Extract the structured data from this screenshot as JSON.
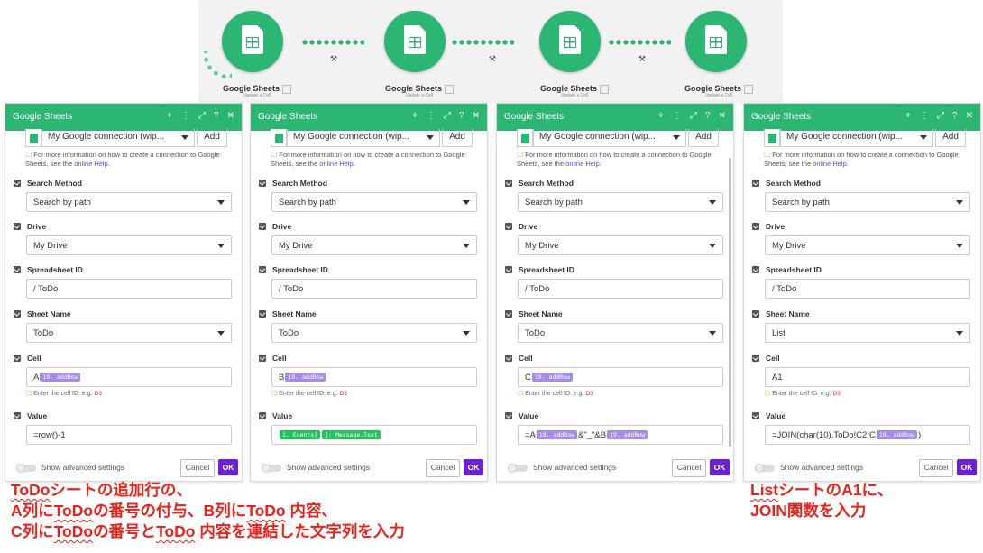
{
  "flow": {
    "nodes": [
      {
        "label": "Google Sheets",
        "sub": "Update a Cell"
      },
      {
        "label": "Google Sheets",
        "sub": "Update a Cell"
      },
      {
        "label": "Google Sheets",
        "sub": "Update a Cell"
      },
      {
        "label": "Google Sheets",
        "sub": "Update a Cell"
      }
    ],
    "accent": "#2bb673"
  },
  "panels": [
    {
      "title": "Google Sheets",
      "connection": "My Google connection (wip...",
      "add": "Add",
      "help_text": "For more information on how to create a connection to Google Sheets, see the",
      "help_link": "online Help.",
      "labels": {
        "search_method": "Search Method",
        "drive": "Drive",
        "spreadsheet_id": "Spreadsheet ID",
        "sheet_name": "Sheet Name",
        "cell": "Cell",
        "value": "Value"
      },
      "search_method": "Search by path",
      "drive": "My Drive",
      "spreadsheet_id": "/ ToDo",
      "sheet_name": "ToDo",
      "cell_prefix": "A",
      "cell_pill": "19. addRow",
      "cell_hint": "Enter the cell ID. e.g.",
      "cell_hint_code": "D3",
      "value_text": "=row()-1",
      "advanced": "Show advanced settings",
      "cancel": "Cancel",
      "ok": "OK"
    },
    {
      "title": "Google Sheets",
      "connection": "My Google connection (wip...",
      "add": "Add",
      "help_text": "For more information on how to create a connection to Google Sheets, see the",
      "help_link": "online Help.",
      "labels": {
        "search_method": "Search Method",
        "drive": "Drive",
        "spreadsheet_id": "Spreadsheet ID",
        "sheet_name": "Sheet Name",
        "cell": "Cell",
        "value": "Value"
      },
      "search_method": "Search by path",
      "drive": "My Drive",
      "spreadsheet_id": "/ ToDo",
      "sheet_name": "ToDo",
      "cell_prefix": "B",
      "cell_pill": "19. addRow",
      "cell_hint": "Enter the cell ID. e.g.",
      "cell_hint_code": "D3",
      "value_pill1": "1. Events[",
      "value_pill2": "]: Message.Text",
      "advanced": "Show advanced settings",
      "cancel": "Cancel",
      "ok": "OK"
    },
    {
      "title": "Google Sheets",
      "connection": "My Google connection (wip...",
      "add": "Add",
      "help_text": "For more information on how to create a connection to Google Sheets, see the",
      "help_link": "online Help.",
      "labels": {
        "search_method": "Search Method",
        "drive": "Drive",
        "spreadsheet_id": "Spreadsheet ID",
        "sheet_name": "Sheet Name",
        "cell": "Cell",
        "value": "Value"
      },
      "search_method": "Search by path",
      "drive": "My Drive",
      "spreadsheet_id": "/ ToDo",
      "sheet_name": "ToDo",
      "cell_prefix": "C",
      "cell_pill": "19. addRow",
      "cell_hint": "Enter the cell ID. e.g.",
      "cell_hint_code": "D3",
      "value_pre": "=A",
      "value_pill1": "19. addRow",
      "value_mid": "&\"_\"&B",
      "value_pill2": "19. addRow",
      "advanced": "Show advanced settings",
      "cancel": "Cancel",
      "ok": "OK"
    },
    {
      "title": "Google Sheets",
      "connection": "My Google connection (wip...",
      "add": "Add",
      "help_text": "For more information on how to create a connection to Google Sheets, see the",
      "help_link": "online Help.",
      "labels": {
        "search_method": "Search Method",
        "drive": "Drive",
        "spreadsheet_id": "Spreadsheet ID",
        "sheet_name": "Sheet Name",
        "cell": "Cell",
        "value": "Value"
      },
      "search_method": "Search by path",
      "drive": "My Drive",
      "spreadsheet_id": "/ ToDo",
      "sheet_name": "List",
      "cell_text": "A1",
      "cell_hint": "Enter the cell ID. e.g.",
      "cell_hint_code": "D3",
      "value_pre": "=JOIN(char(10),ToDo!C2:C",
      "value_pill1": "19. addRow",
      "value_post": ")",
      "advanced": "Show advanced settings",
      "cancel": "Cancel",
      "ok": "OK"
    }
  ],
  "captions": {
    "left": [
      "ToDoシートの追加行の、",
      "A列にToDoの番号の付与、B列にToDo 内容、",
      "C列にToDoの番号とToDo 内容を連結した文字列を入力"
    ],
    "right": [
      "ListシートのA1に、",
      "JOIN関数を入力"
    ],
    "color": "#e8231c"
  }
}
